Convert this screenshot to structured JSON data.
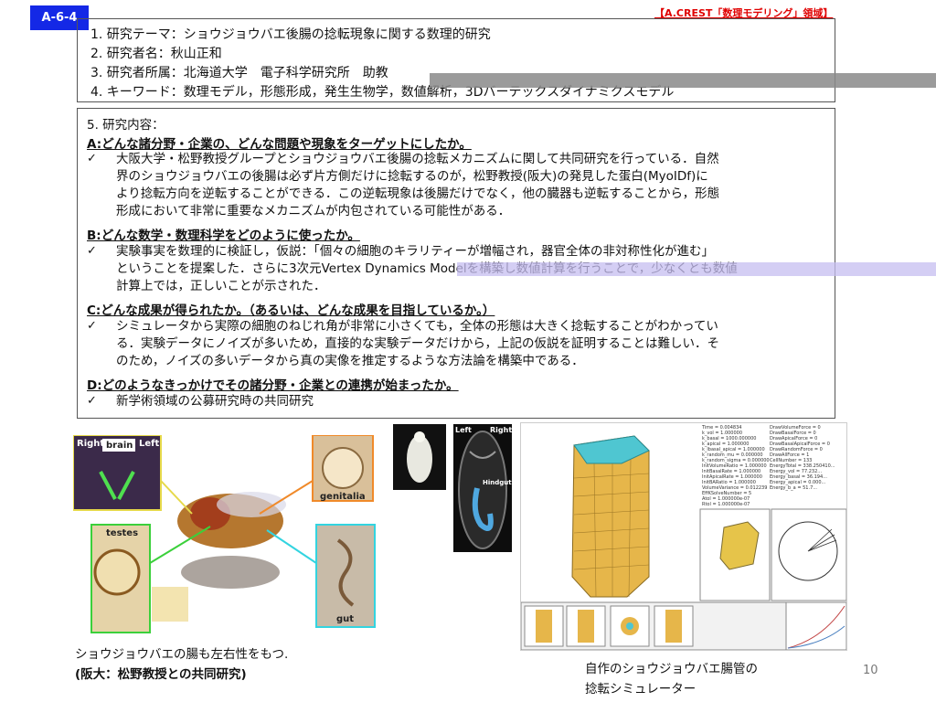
{
  "slide": {
    "badge": "A-6-4",
    "tagline": "【A.CREST「数理モデリング」領域】",
    "page_number": "10"
  },
  "summary_box": {
    "lines": [
      "1. 研究テーマ：ショウジョウバエ後腸の捻転現象に関する数理的研究",
      "2. 研究者名：秋山正和",
      "3. 研究者所属：北海道大学　電子科学研究所　助教",
      "4. キーワード：数理モデル，形態形成，発生生物学，数値解析，3Dバーテックスダイナミクスモデル"
    ]
  },
  "content_box": {
    "title": "5. 研究内容：",
    "sections": [
      {
        "heading": "A:どんな諸分野・企業の、どんな問題や現象をターゲットにしたか。",
        "body": [
          "大阪大学・松野教授グループとショウジョウバエ後腸の捻転メカニズムに関して共同研究を行っている．自然",
          "界のショウジョウバエの後腸は必ず片方側だけに捻転するのが，松野教授(阪大)の発見した蛋白(MyoⅠDf)に",
          "より捻転方向を逆転することができる．この逆転現象は後腸だけでなく，他の臓器も逆転することから，形態",
          "形成において非常に重要なメカニズムが内包されている可能性がある．"
        ]
      },
      {
        "heading": "B:どんな数学・数理科学をどのように使ったか。",
        "body": [
          "実験事実を数理的に検証し，仮説：「個々の細胞のキラリティーが増幅され，器官全体の非対称性化が進む」",
          "ということを提案した．さらに3次元Vertex Dynamics Modelを構築し数値計算を行うことで，少なくとも数値",
          "計算上では，正しいことが示された．"
        ]
      },
      {
        "heading": "C:どんな成果が得られたか。（あるいは、どんな成果を目指しているか。）",
        "body": [
          "シミュレータから実際の細胞のねじれ角が非常に小さくても，全体の形態は大きく捻転することがわかってい",
          "る．実験データにノイズが多いため，直接的な実験データだけから，上記の仮説を証明することは難しい．そ",
          "のため，ノイズの多いデータから真の実像を推定するような方法論を構築中である．"
        ]
      },
      {
        "heading": "D:どのようなきっかけでその諸分野・企業との連携が始まったか。",
        "body": [
          "新学術領域の公募研究時の共同研究"
        ]
      }
    ]
  },
  "figure_left": {
    "labels": {
      "brain": "brain",
      "right1": "Right",
      "left1": "Left",
      "genitalia": "genitalia",
      "testes": "testes",
      "gut": "gut"
    },
    "caption_line1": "ショウジョウバエの腸も左右性をもつ.",
    "caption_line2": "(阪大：松野教授との共同研究)"
  },
  "figure_mid": {
    "labels": {
      "left": "Left",
      "right": "Right",
      "hindgut": "Hindgut"
    }
  },
  "figure_right": {
    "caption_line1": "自作のショウジョウバエ腸管の",
    "caption_line2": "捻転シミュレーター",
    "sim_params_left": "Time = 0.004834\nk_vol = 1.000000\nk_basal = 1000.000000\nk_apical = 1.000000\nk_lbasal_apical = 1.000000\nk_random_mu = 0.000000\nk_random_sigma = 0.000000\nInitVolumeRatio = 1.000000\nInitBasalRate = 1.000000\nInitApicalRate = 1.000000\nInitBARatio = 1.000000\nVolumeVariance = 0.012239\nEffKSolveNumber = 5\nAtol = 1.000000e-07\nRtol = 1.000000e-07",
    "sim_params_right": "DrawVolumeForce = 0\nDrawBasalForce = 0\nDrawApicalForce = 0\nDrawBasalApicalForce = 0\nDrawRandomForce = 0\nDrawAllForce = 1\nCellNumber = 133\nEnergyTotal = 338.250410...\nEnergy_vol = 77.232...\nEnergy_basal = 36.194...\nEnergy_apical = 0.000...\nEnergy_b_a = 51.7...",
    "colors": {
      "cylinder": "#e6b64a",
      "cap": "#4fc6d1"
    }
  }
}
